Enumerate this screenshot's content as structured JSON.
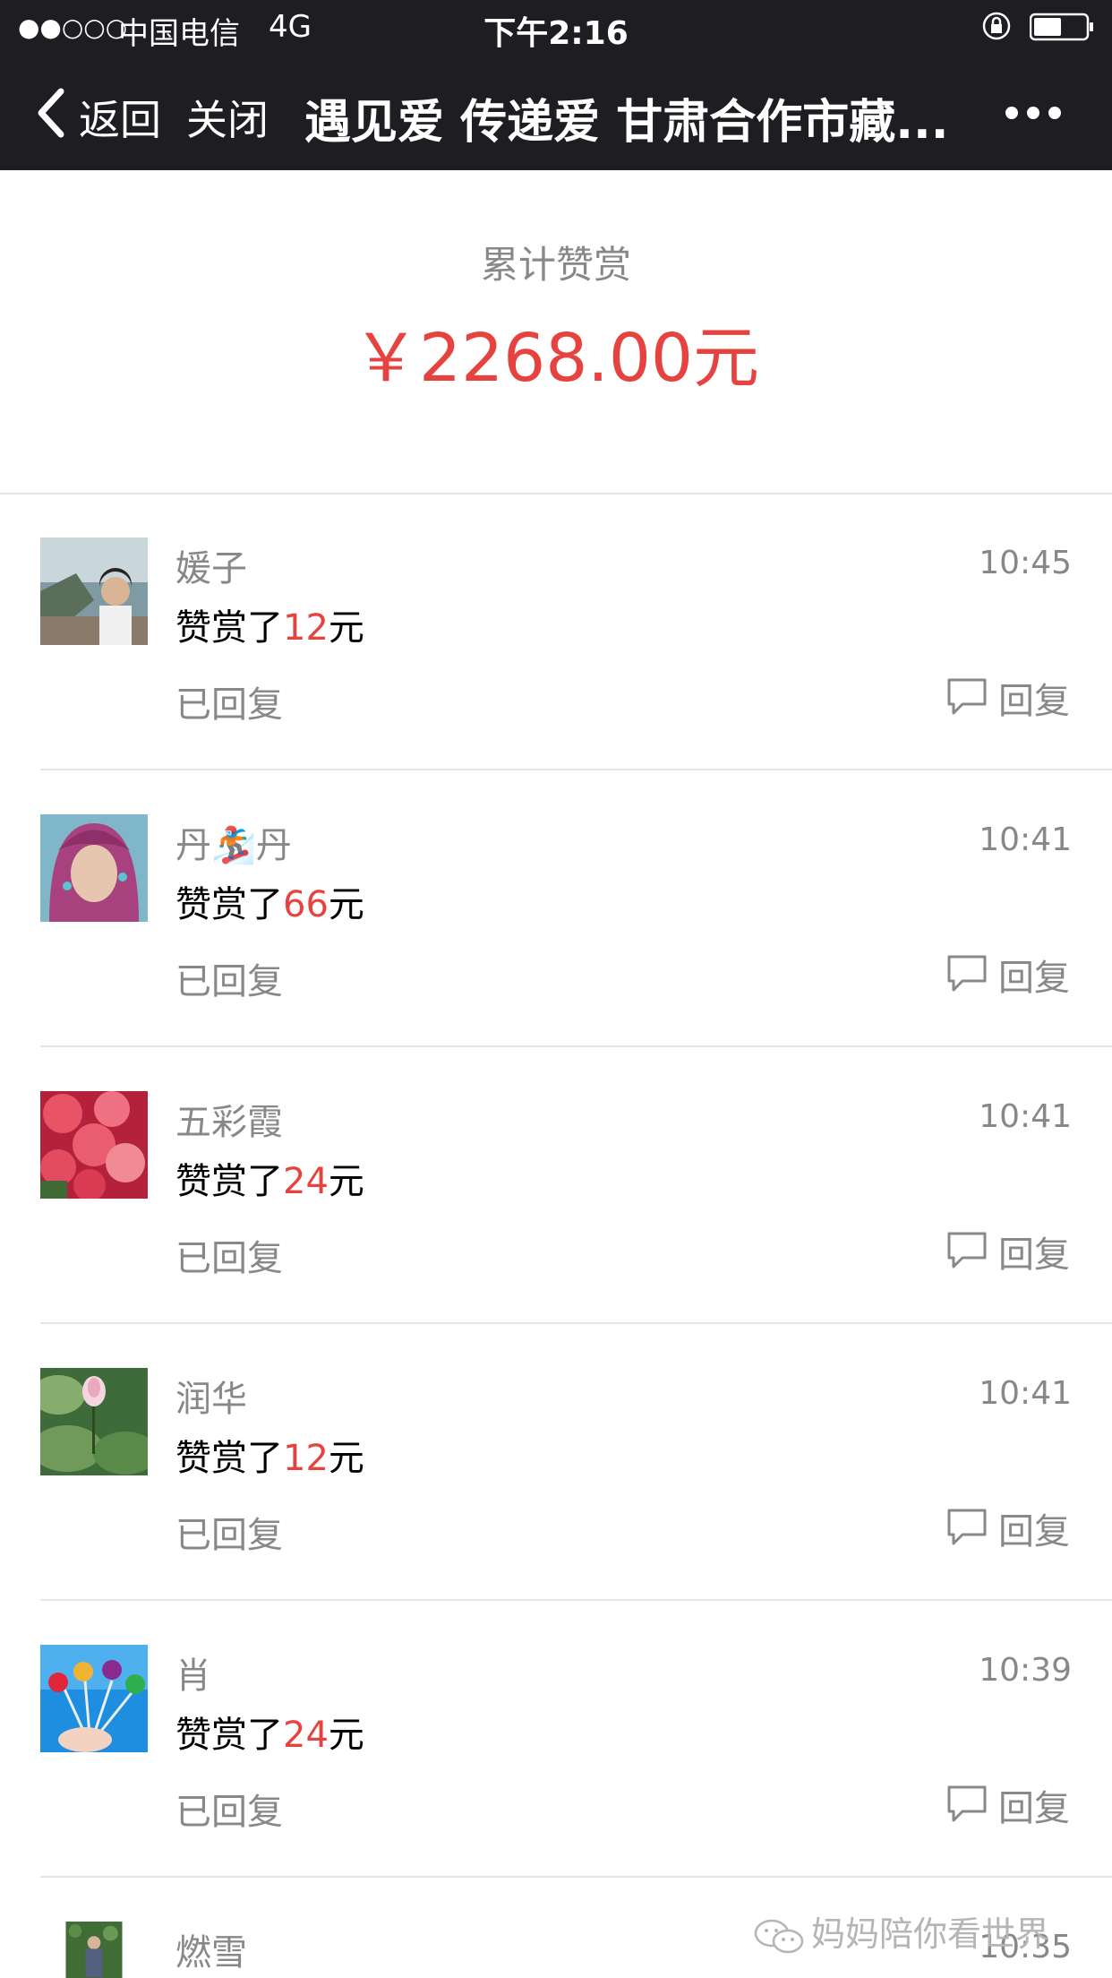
{
  "status_bar": {
    "signal": "●●○○○",
    "carrier": "中国电信",
    "network": "4G",
    "time": "下午2:16"
  },
  "nav": {
    "back_label": "返回",
    "close_label": "关闭",
    "title": "遇见爱 传递爱 甘肃合作市藏..."
  },
  "summary": {
    "label": "累计赞赏",
    "amount": "￥2268.00元"
  },
  "rewards": [
    {
      "name": "媛子",
      "time": "10:45",
      "prefix": "赞赏了",
      "amount": "12",
      "suffix": "元",
      "status": "已回复",
      "reply": "回复"
    },
    {
      "name": "丹🏂丹",
      "time": "10:41",
      "prefix": "赞赏了",
      "amount": "66",
      "suffix": "元",
      "status": "已回复",
      "reply": "回复"
    },
    {
      "name": "五彩霞",
      "time": "10:41",
      "prefix": "赞赏了",
      "amount": "24",
      "suffix": "元",
      "status": "已回复",
      "reply": "回复"
    },
    {
      "name": "润华",
      "time": "10:41",
      "prefix": "赞赏了",
      "amount": "12",
      "suffix": "元",
      "status": "已回复",
      "reply": "回复"
    },
    {
      "name": "肖",
      "time": "10:39",
      "prefix": "赞赏了",
      "amount": "24",
      "suffix": "元",
      "status": "已回复",
      "reply": "回复"
    },
    {
      "name": "燃雪",
      "time": "10:35"
    }
  ],
  "watermark": "妈妈陪你看世界",
  "colors": {
    "nav_bg": "#1e1e22",
    "accent_red": "#e64340",
    "muted_text": "#888888"
  }
}
